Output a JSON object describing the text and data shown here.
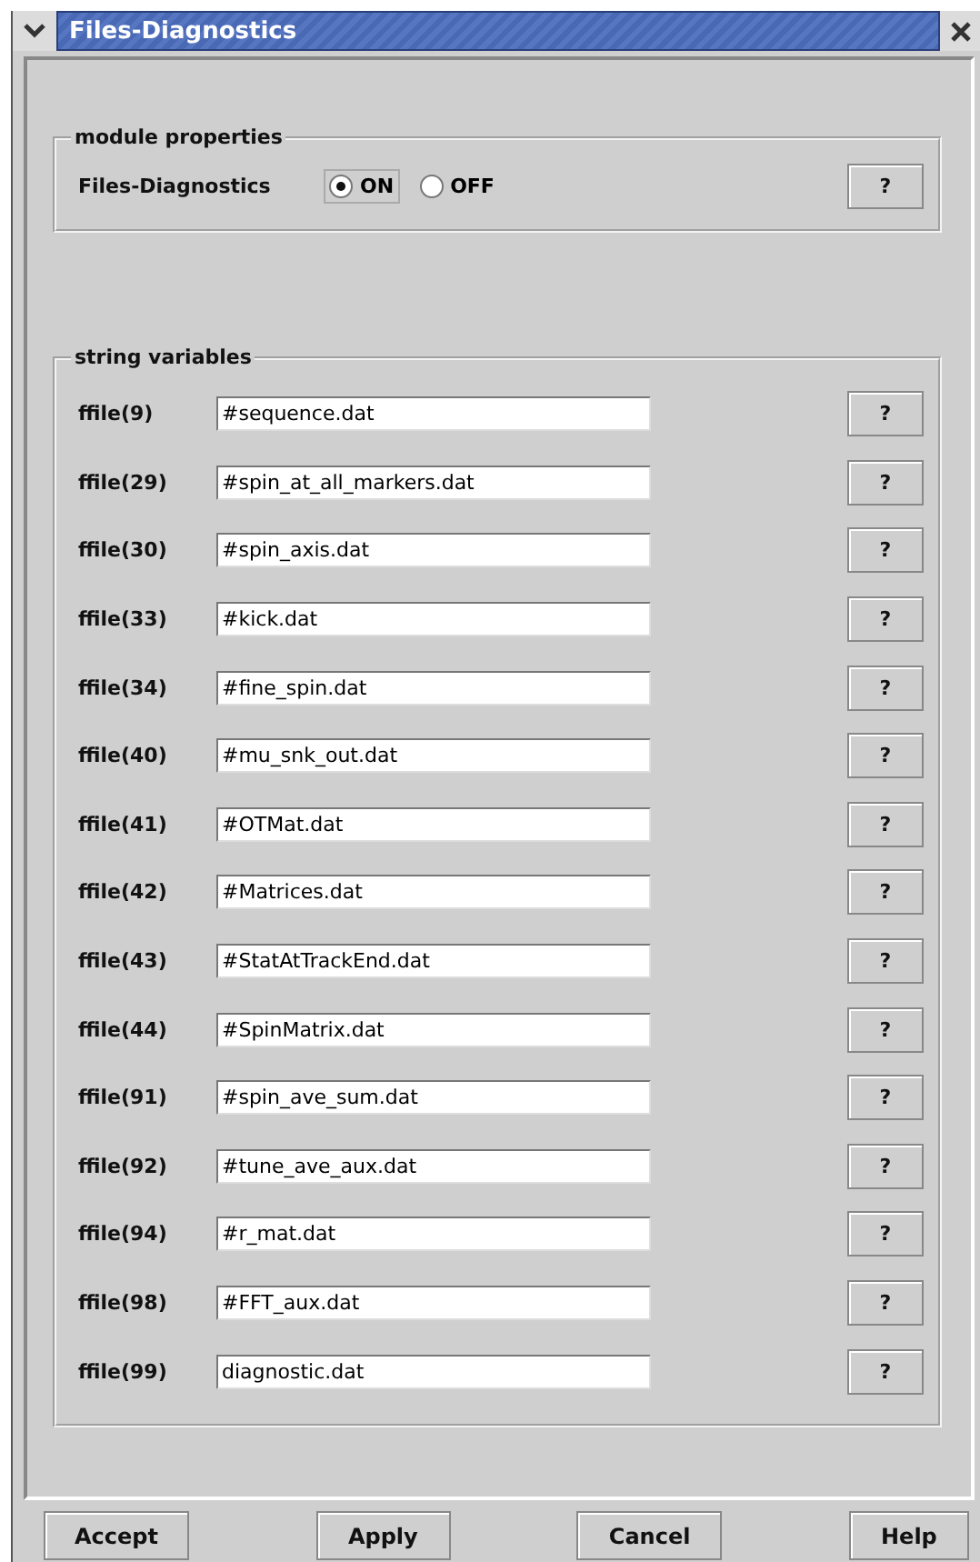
{
  "window": {
    "title": "Files-Diagnostics"
  },
  "module_properties": {
    "title": "module properties",
    "label": "Files-Diagnostics",
    "help": "?",
    "options": [
      {
        "label": "ON",
        "selected": true
      },
      {
        "label": "OFF",
        "selected": false
      }
    ]
  },
  "string_variables": {
    "title": "string variables",
    "rows": [
      {
        "label": "ffile(9)",
        "value": "#sequence.dat",
        "help": "?"
      },
      {
        "label": "ffile(29)",
        "value": "#spin_at_all_markers.dat",
        "help": "?"
      },
      {
        "label": "ffile(30)",
        "value": "#spin_axis.dat",
        "help": "?"
      },
      {
        "label": "ffile(33)",
        "value": "#kick.dat",
        "help": "?"
      },
      {
        "label": "ffile(34)",
        "value": "#fine_spin.dat",
        "help": "?"
      },
      {
        "label": "ffile(40)",
        "value": "#mu_snk_out.dat",
        "help": "?"
      },
      {
        "label": "ffile(41)",
        "value": "#OTMat.dat",
        "help": "?"
      },
      {
        "label": "ffile(42)",
        "value": "#Matrices.dat",
        "help": "?"
      },
      {
        "label": "ffile(43)",
        "value": "#StatAtTrackEnd.dat",
        "help": "?"
      },
      {
        "label": "ffile(44)",
        "value": "#SpinMatrix.dat",
        "help": "?"
      },
      {
        "label": "ffile(91)",
        "value": "#spin_ave_sum.dat",
        "help": "?"
      },
      {
        "label": "ffile(92)",
        "value": "#tune_ave_aux.dat",
        "help": "?"
      },
      {
        "label": "ffile(94)",
        "value": "#r_mat.dat",
        "help": "?"
      },
      {
        "label": "ffile(98)",
        "value": "#FFT_aux.dat",
        "help": "?"
      },
      {
        "label": "ffile(99)",
        "value": "diagnostic.dat",
        "help": "?"
      }
    ]
  },
  "buttons": [
    "Accept",
    "Apply",
    "Cancel",
    "Help"
  ]
}
